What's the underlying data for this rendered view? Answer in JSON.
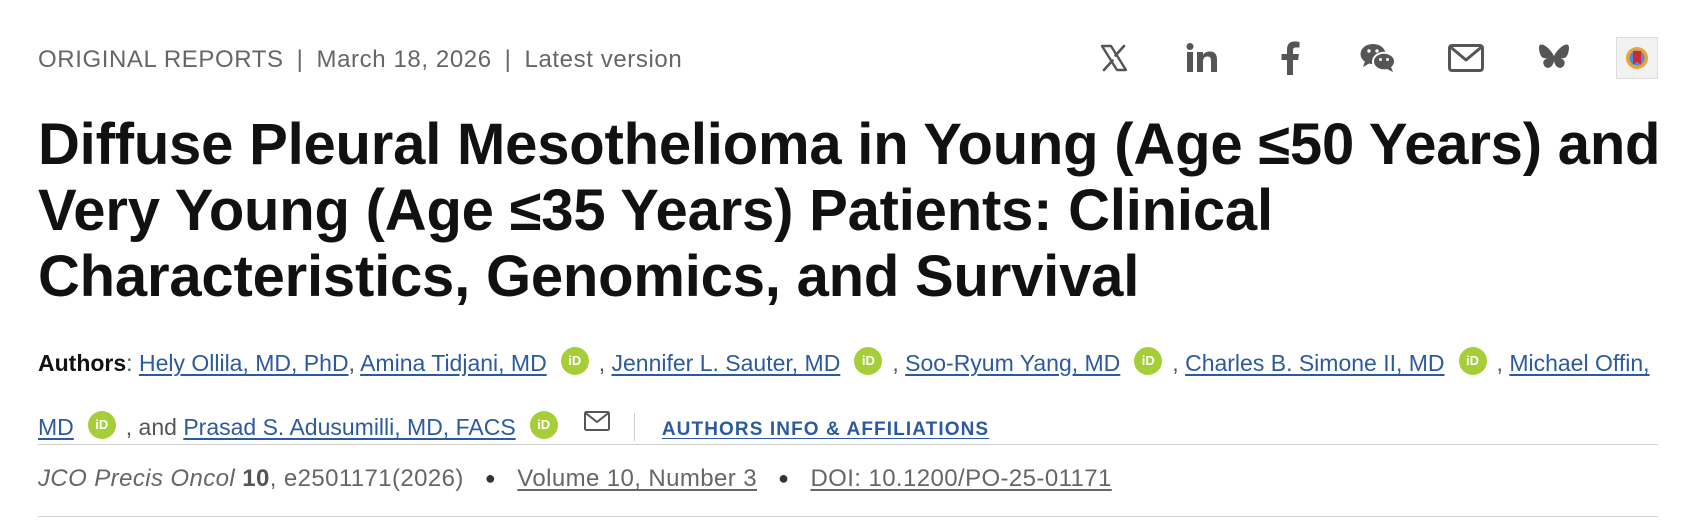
{
  "meta": {
    "type": "ORIGINAL REPORTS",
    "date": "March 18, 2026",
    "version": "Latest version"
  },
  "share_icons": [
    "x-icon",
    "linkedin-icon",
    "facebook-icon",
    "wechat-icon",
    "email-icon",
    "bluesky-icon",
    "mendeley-icon"
  ],
  "title": "Diffuse Pleural Mesothelioma in Young (Age ≤50 Years) and Very Young (Age ≤35 Years) Patients: Clinical Characteristics, Genomics, and Survival",
  "authors": {
    "label": "Authors",
    "list": [
      "Hely Ollila, MD, PhD",
      "Amina Tidjani, MD",
      "Jennifer L. Sauter, MD",
      "Soo-Ryum Yang, MD",
      "Charles B. Simone II, MD",
      "Michael Offin, MD",
      "Prasad S. Adusumilli, MD, FACS"
    ],
    "and": ", and",
    "affiliations_link": "AUTHORS INFO & AFFILIATIONS",
    "orcid_text": "iD"
  },
  "citation": {
    "journal": "JCO Precis Oncol",
    "volume_bold": "10",
    "article": ", e2501171(2026)",
    "issue": "Volume 10, Number 3",
    "doi": "DOI: 10.1200/PO-25-01171"
  },
  "colors": {
    "link": "#2c5aa0",
    "orcid": "#a6ce39",
    "meta_text": "#666666"
  }
}
